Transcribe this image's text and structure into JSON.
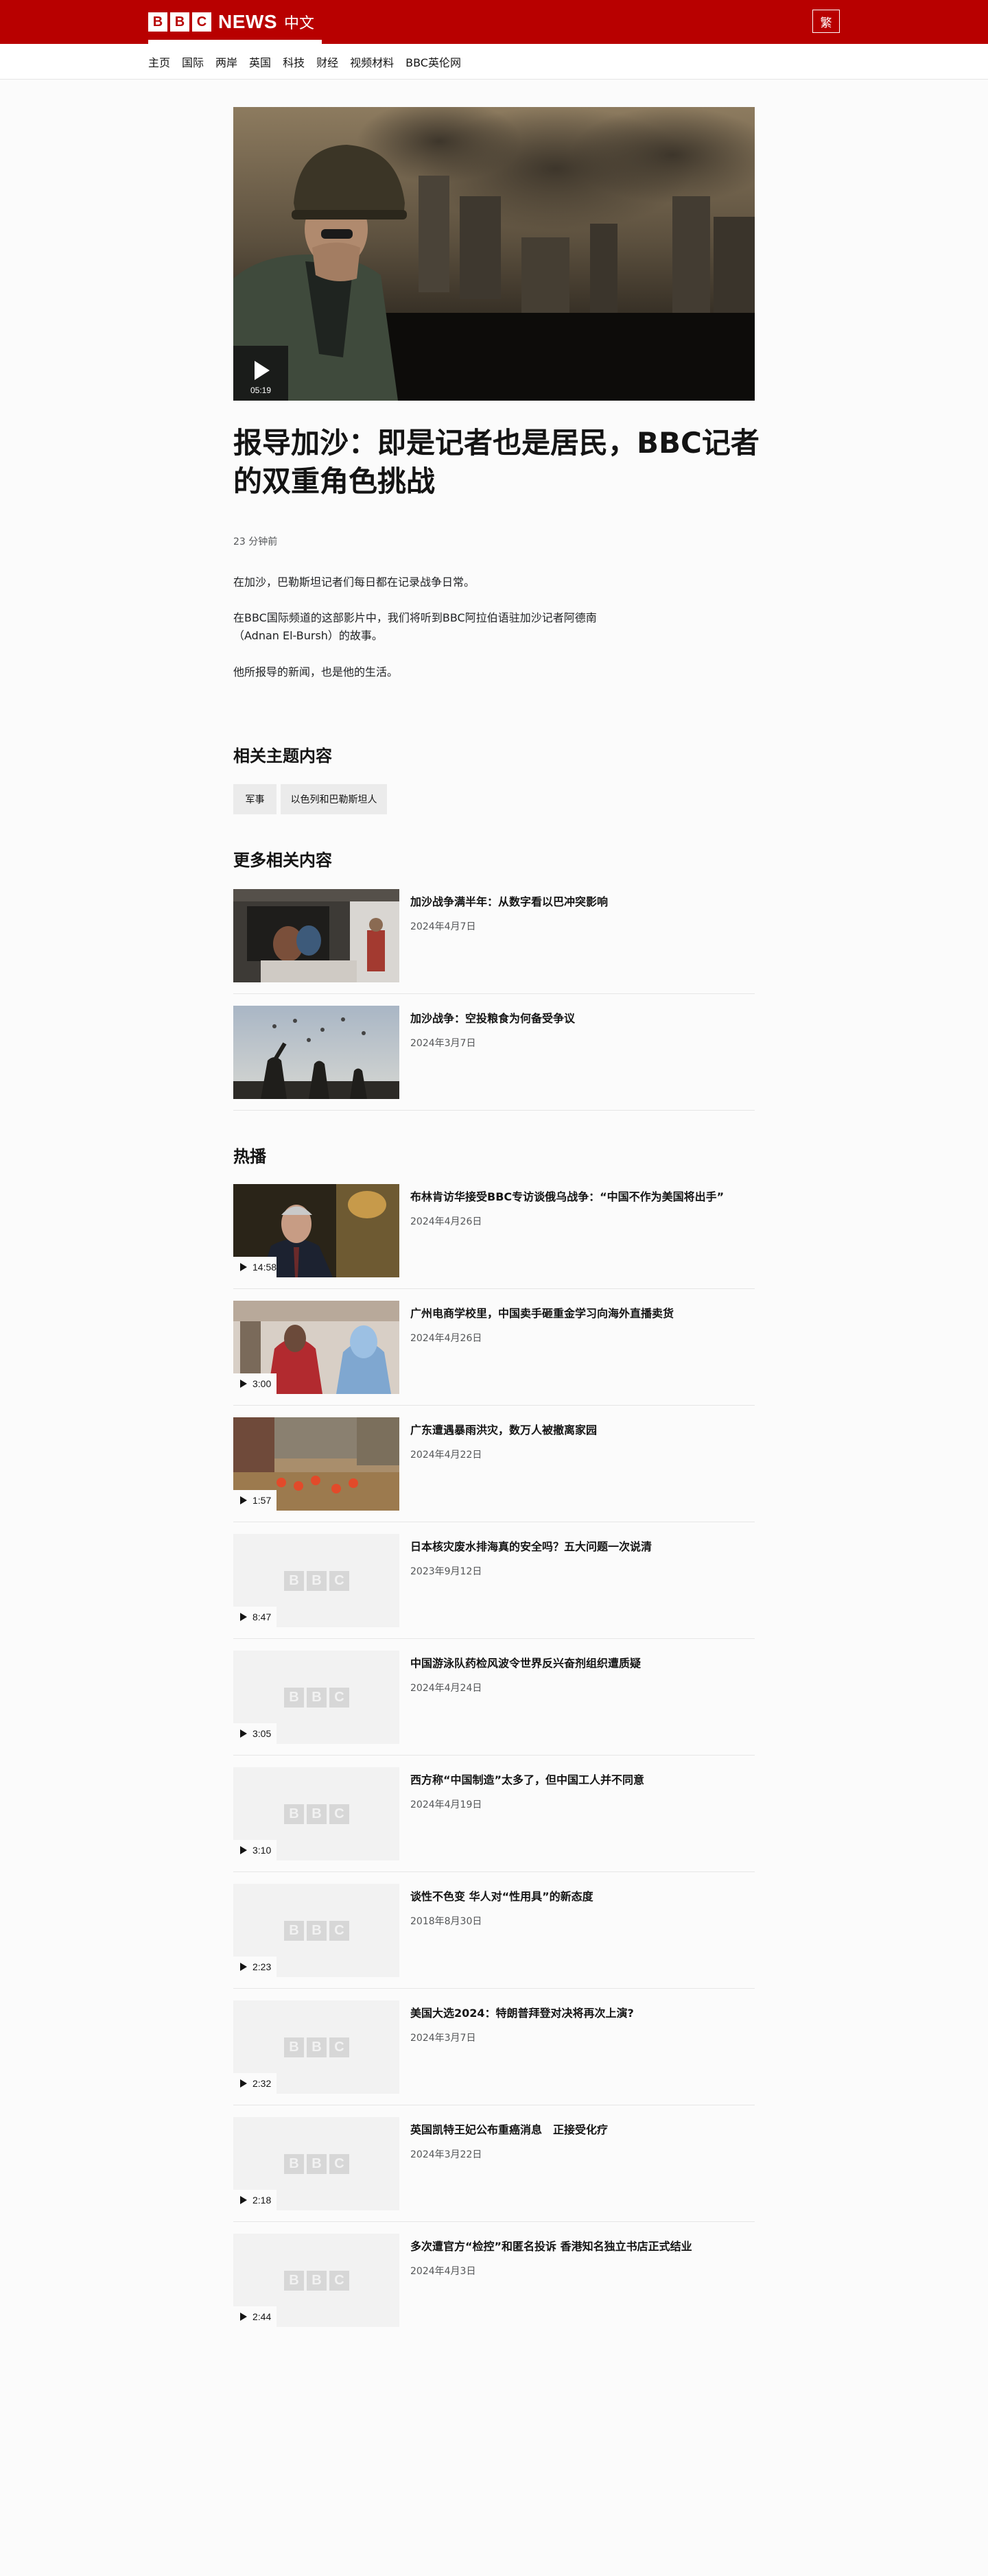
{
  "header": {
    "logo_letters": [
      "B",
      "B",
      "C"
    ],
    "logo_news": "NEWS",
    "logo_lang": "中文",
    "script_toggle": "繁"
  },
  "nav": {
    "items": [
      "主页",
      "国际",
      "两岸",
      "英国",
      "科技",
      "财经",
      "视频材料",
      "BBC英伦网"
    ]
  },
  "article": {
    "video_duration": "05:19",
    "headline": "报导加沙：即是记者也是居民，BBC记者的双重角色挑战",
    "timestamp": "23 分钟前",
    "paragraphs": [
      "在加沙，巴勒斯坦记者们每日都在记录战争日常。",
      "在BBC国际频道的这部影片中，我们将听到BBC阿拉伯语驻加沙记者阿德南（Adnan El-Bursh）的故事。",
      "他所报导的新闻，也是他的生活。"
    ]
  },
  "related_topics": {
    "title": "相关主题内容",
    "tags": [
      "军事",
      "以色列和巴勒斯坦人"
    ]
  },
  "more_related": {
    "title": "更多相关内容",
    "items": [
      {
        "title": "加沙战争满半年：从数字看以巴冲突影响",
        "date": "2024年4月7日"
      },
      {
        "title": "加沙战争：空投粮食为何备受争议",
        "date": "2024年3月7日"
      }
    ]
  },
  "popular": {
    "title": "热播",
    "items": [
      {
        "title": "布林肯访华接受BBC专访谈俄乌战争：“中国不作为美国将出手”",
        "date": "2024年4月26日",
        "duration": "14:58"
      },
      {
        "title": "广州电商学校里，中国卖手砸重金学习向海外直播卖货",
        "date": "2024年4月26日",
        "duration": "3:00"
      },
      {
        "title": "广东遭遇暴雨洪灾，数万人被撤离家园",
        "date": "2024年4月22日",
        "duration": "1:57"
      },
      {
        "title": "日本核灾废水排海真的安全吗？五大问题一次说清",
        "date": "2023年9月12日",
        "duration": "8:47"
      },
      {
        "title": "中国游泳队药检风波令世界反兴奋剂组织遭质疑",
        "date": "2024年4月24日",
        "duration": "3:05"
      },
      {
        "title": "西方称“中国制造”太多了，但中国工人并不同意",
        "date": "2024年4月19日",
        "duration": "3:10"
      },
      {
        "title": "谈性不色变 华人对“性用具”的新态度",
        "date": "2018年8月30日",
        "duration": "2:23"
      },
      {
        "title": "美国大选2024：特朗普拜登对决将再次上演?",
        "date": "2024年3月7日",
        "duration": "2:32"
      },
      {
        "title": "英国凯特王妃公布重癌消息　正接受化疗",
        "date": "2024年3月22日",
        "duration": "2:18"
      },
      {
        "title": "多次遭官方“检控”和匿名投诉 香港知名独立书店正式结业",
        "date": "2024年4月3日",
        "duration": "2:44"
      }
    ]
  },
  "colors": {
    "brand_red": "#b80000",
    "background": "#fbfbfb",
    "placeholder": "#f2f2f2"
  }
}
